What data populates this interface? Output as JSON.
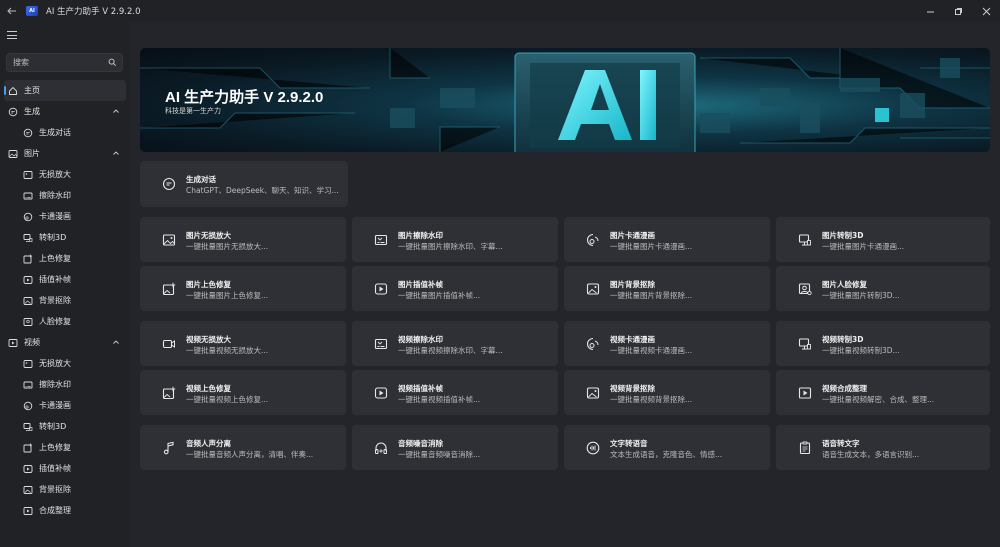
{
  "window": {
    "title": "AI 生产力助手 V 2.9.2.0",
    "logo_text": "AI"
  },
  "search": {
    "placeholder": "搜索"
  },
  "nav": {
    "home": "主页",
    "gen_group": "生成",
    "gen_items": [
      "生成对话"
    ],
    "image_group": "图片",
    "image_items": [
      "无损放大",
      "擦除水印",
      "卡通漫画",
      "转制3D",
      "上色修复",
      "插值补帧",
      "背景抠除",
      "人脸修复"
    ],
    "video_group": "视频",
    "video_items": [
      "无损放大",
      "擦除水印",
      "卡通漫画",
      "转制3D",
      "上色修复",
      "插值补帧",
      "背景抠除",
      "合成整理"
    ]
  },
  "banner": {
    "title": "AI 生产力助手 V 2.9.2.0",
    "subtitle": "科技是第一生产力",
    "art_text": "AI"
  },
  "cards": {
    "chat": {
      "title": "生成对话",
      "desc": "ChatGPT、DeepSeek、聊天、知识、学习..."
    },
    "img_upscale": {
      "title": "图片无损放大",
      "desc": "一键批量图片无损放大..."
    },
    "img_watermark": {
      "title": "图片擦除水印",
      "desc": "一键批量图片擦除水印、字幕..."
    },
    "img_cartoon": {
      "title": "图片卡通漫画",
      "desc": "一键批量图片卡通漫画..."
    },
    "img_3d": {
      "title": "图片转制3D",
      "desc": "一键批量图片卡通漫画..."
    },
    "img_colorize": {
      "title": "图片上色修复",
      "desc": "一键批量图片上色修复..."
    },
    "img_interp": {
      "title": "图片插值补帧",
      "desc": "一键批量图片插值补帧..."
    },
    "img_bg": {
      "title": "图片背景抠除",
      "desc": "一键批量图片背景抠除..."
    },
    "img_face": {
      "title": "图片人脸修复",
      "desc": "一键批量图片转制3D..."
    },
    "vid_upscale": {
      "title": "视频无损放大",
      "desc": "一键批量视频无损放大..."
    },
    "vid_watermark": {
      "title": "视频擦除水印",
      "desc": "一键批量视频擦除水印、字幕..."
    },
    "vid_cartoon": {
      "title": "视频卡通漫画",
      "desc": "一键批量视频卡通漫画..."
    },
    "vid_3d": {
      "title": "视频转制3D",
      "desc": "一键批量视频转制3D..."
    },
    "vid_colorize": {
      "title": "视频上色修复",
      "desc": "一键批量视频上色修复..."
    },
    "vid_interp": {
      "title": "视频插值补帧",
      "desc": "一键批量视频插值补帧..."
    },
    "vid_bg": {
      "title": "视频背景抠除",
      "desc": "一键批量视频背景抠除..."
    },
    "vid_merge": {
      "title": "视频合成整理",
      "desc": "一键批量视频解密、合成、整理..."
    },
    "audio_sep": {
      "title": "音频人声分离",
      "desc": "一键批量音频人声分离，清唱、伴奏..."
    },
    "audio_denoise": {
      "title": "音频噪音消除",
      "desc": "一键批量音频噪音消除..."
    },
    "tts": {
      "title": "文字转语音",
      "desc": "文本生成语音，克隆音色、情感..."
    },
    "stt": {
      "title": "语音转文字",
      "desc": "语音生成文本，多语言识别..."
    }
  },
  "colors": {
    "accent": "#4a9df0",
    "background": "#23252a",
    "sidebar": "#202226",
    "card": "#2e3035"
  }
}
